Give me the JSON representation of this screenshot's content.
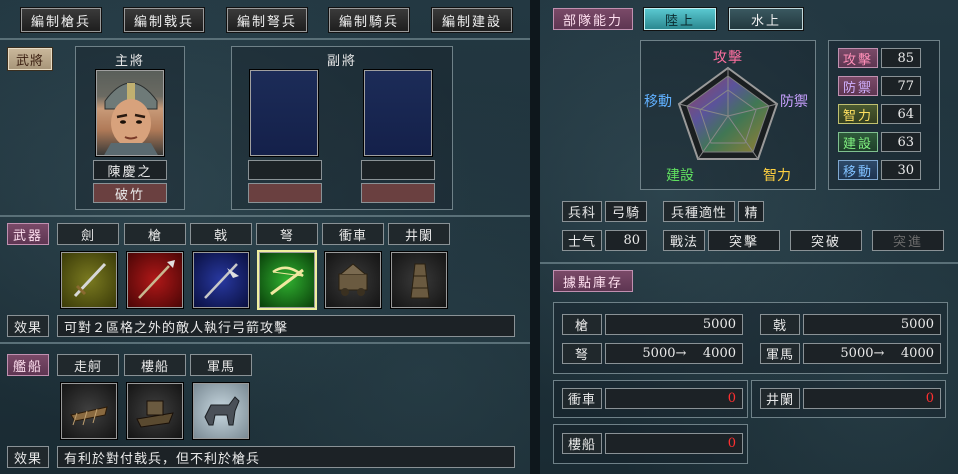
{
  "top_buttons": [
    "編制槍兵",
    "編制戟兵",
    "編制弩兵",
    "編制騎兵",
    "編制建設"
  ],
  "officers": {
    "section_tag": "武將",
    "main_label": "主將",
    "deputy_label": "副將",
    "main_name": "陳慶之",
    "main_skill": "破竹"
  },
  "weapons": {
    "tag": "武器",
    "labels": [
      "劍",
      "槍",
      "戟",
      "弩",
      "衝車",
      "井闌"
    ],
    "selected": "弩",
    "effect_label": "效果",
    "effect_text": "可對２區格之外的敵人執行弓箭攻擊"
  },
  "ships": {
    "tag": "艦船",
    "labels": [
      "走舸",
      "樓船",
      "軍馬"
    ],
    "effect_label": "效果",
    "effect_text": "有利於對付戟兵，但不利於槍兵"
  },
  "unit_ability": {
    "tag": "部隊能力",
    "tab_land": "陸上",
    "tab_water": "水上",
    "radar_labels": {
      "attack": "攻擊",
      "defense": "防禦",
      "intelligence": "智力",
      "build": "建設",
      "move": "移動"
    },
    "stats": [
      {
        "label": "攻擊",
        "value": "85"
      },
      {
        "label": "防禦",
        "value": "77"
      },
      {
        "label": "智力",
        "value": "64"
      },
      {
        "label": "建設",
        "value": "63"
      },
      {
        "label": "移動",
        "value": "30"
      }
    ],
    "troop_type_label": "兵科",
    "troop_type_value": "弓騎",
    "aptitude_label": "兵種適性",
    "aptitude_value": "精",
    "morale_label": "士气",
    "morale_value": "80",
    "tactics_label": "戰法",
    "tactics": [
      "突擊",
      "突破",
      "突進"
    ]
  },
  "inventory": {
    "tag": "據點庫存",
    "items": [
      {
        "label": "槍",
        "value": "5000"
      },
      {
        "label": "戟",
        "value": "5000"
      },
      {
        "label": "弩",
        "value": "5000→    4000"
      },
      {
        "label": "軍馬",
        "value": "5000→    4000"
      },
      {
        "label": "衝車",
        "value": "0"
      },
      {
        "label": "井闌",
        "value": "0"
      },
      {
        "label": "樓船",
        "value": "0"
      }
    ]
  },
  "colors": {
    "pink_tag": "#6a4060",
    "tab_active": "#3fa8b0",
    "attack": "#ff6fa0",
    "defense": "#c8a0ff",
    "intelligence": "#ffd040",
    "build": "#60e060",
    "move": "#60b0ff",
    "zero_value": "#ff3030"
  }
}
